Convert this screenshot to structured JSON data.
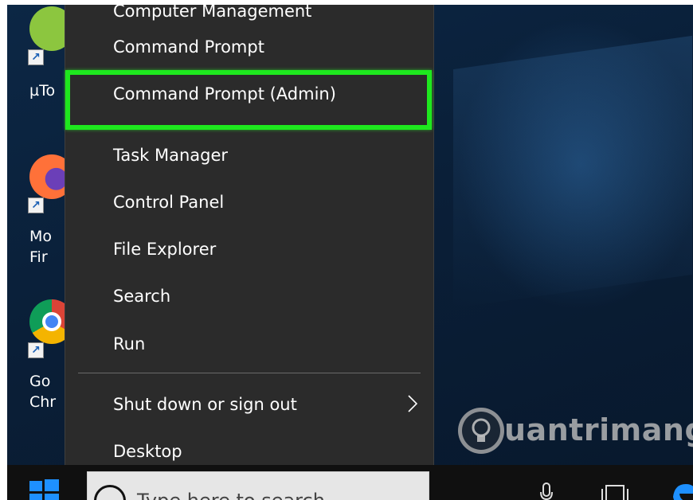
{
  "desktop": {
    "icons": [
      {
        "name": "utorrent",
        "label": "µTo",
        "color": "#8cc63f"
      },
      {
        "name": "firefox",
        "label_lines": [
          "Mo",
          "Fir"
        ],
        "color": "#ff7139"
      },
      {
        "name": "chrome",
        "label_lines": [
          "Go",
          "Chr"
        ],
        "color": "#db4437"
      }
    ]
  },
  "context_menu": {
    "cut_item": "Computer Management",
    "items": [
      {
        "label": "Command Prompt"
      },
      {
        "label": "Command Prompt (Admin)",
        "highlighted": true
      },
      {
        "label": "Task Manager"
      },
      {
        "label": "Control Panel"
      },
      {
        "label": "File Explorer"
      },
      {
        "label": "Search"
      },
      {
        "label": "Run"
      },
      {
        "label": "Shut down or sign out",
        "has_submenu": true
      },
      {
        "label": "Desktop"
      }
    ],
    "highlight_color": "#1ee81e"
  },
  "taskbar": {
    "search_placeholder": "Type here to search"
  },
  "watermark": {
    "text": "uantrimang",
    "icon": "lightbulb-icon"
  }
}
